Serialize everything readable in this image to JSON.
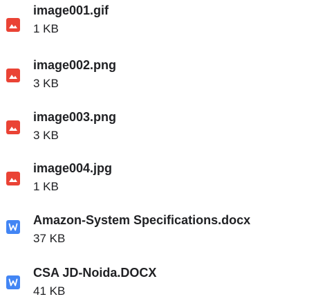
{
  "attachments": [
    {
      "name": "image001.gif",
      "size": "1 KB",
      "icon": "image-file-icon",
      "icon_color": "#ea4335"
    },
    {
      "name": "image002.png",
      "size": "3 KB",
      "icon": "image-file-icon",
      "icon_color": "#ea4335"
    },
    {
      "name": "image003.png",
      "size": "3 KB",
      "icon": "image-file-icon",
      "icon_color": "#ea4335"
    },
    {
      "name": "image004.jpg",
      "size": "1 KB",
      "icon": "image-file-icon",
      "icon_color": "#ea4335"
    },
    {
      "name": "Amazon-System Specifications.docx",
      "size": "37 KB",
      "icon": "word-doc-icon",
      "icon_color": "#4285f4"
    },
    {
      "name": "CSA JD-Noida.DOCX",
      "size": "41 KB",
      "icon": "word-doc-icon",
      "icon_color": "#4285f4"
    }
  ]
}
